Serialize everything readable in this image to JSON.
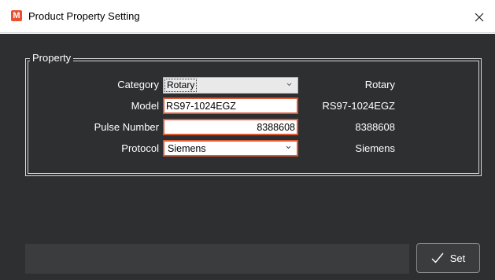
{
  "window": {
    "title": "Product Property Setting",
    "app_icon_letter": "M",
    "app_icon_color": "#e8502e"
  },
  "group": {
    "legend": "Property"
  },
  "rows": [
    {
      "label": "Category",
      "value": "Rotary",
      "readout": "Rotary",
      "control": "combo"
    },
    {
      "label": "Model",
      "value": "RS97-1024EGZ",
      "readout": "RS97-1024EGZ",
      "control": "text"
    },
    {
      "label": "Pulse Number",
      "value": "8388608",
      "readout": "8388608",
      "control": "text"
    },
    {
      "label": "Protocol",
      "value": "Siemens",
      "readout": "Siemens",
      "control": "combo"
    }
  ],
  "footer": {
    "set_label": "Set",
    "set_icon": "checkmark-icon"
  },
  "colors": {
    "background": "#2e2f30",
    "highlight_border": "#e05a35",
    "text": "#ffffff"
  }
}
